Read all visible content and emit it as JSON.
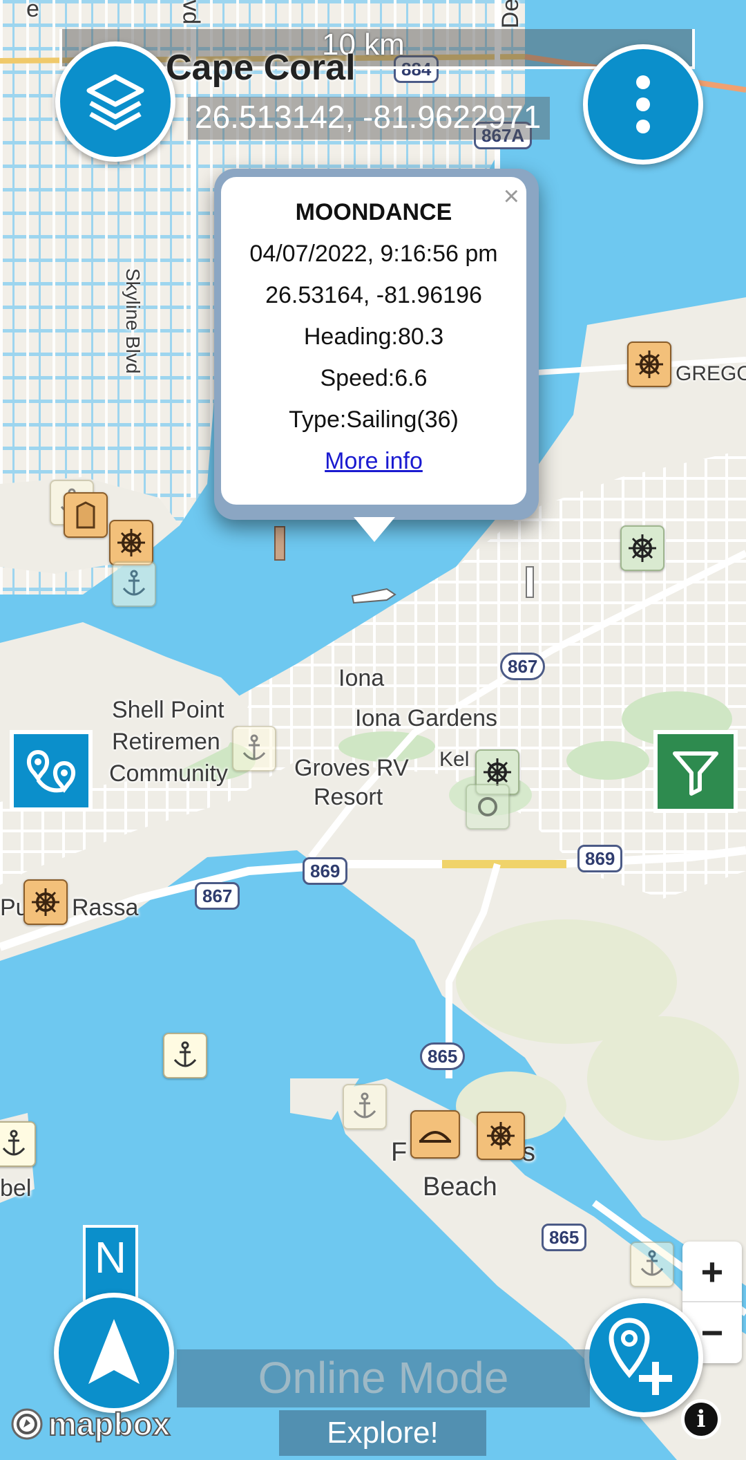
{
  "top_bar": {
    "scale_label": "10 km",
    "city_label": "Cape Coral",
    "coordinates": "26.513142, -81.9622971"
  },
  "popup": {
    "vessel_name": "MOONDANCE",
    "datetime": "04/07/2022, 9:16:56 pm",
    "position": "26.53164, -81.96196",
    "heading": "Heading:80.3",
    "speed": "Speed:6.6",
    "type": "Type:Sailing(36)",
    "more_info_link": "More info",
    "close_glyph": "×"
  },
  "map_labels": {
    "skyline": "Skyline Blvd",
    "gregory": "GREGO",
    "iona": "Iona",
    "iona_gardens": "Iona Gardens",
    "shell_point": "Shell Point",
    "retirement": "Retiremen",
    "community": "Community",
    "groves": "Groves RV",
    "resort": "Resort",
    "kel": "Kel",
    "punta_rassa_a": "Pu",
    "punta_rassa_b": "Rassa",
    "fort_myers_a": "F",
    "fort_myers_b": "s",
    "beach": "Beach",
    "sanibel": "bel",
    "top_left_road": "e",
    "top_road_d": "vd",
    "top_road_de": "De",
    "road_shields": [
      "884",
      "867A",
      "867",
      "869",
      "867",
      "869",
      "865",
      "865"
    ]
  },
  "controls": {
    "north_label": "N",
    "zoom_in": "+",
    "zoom_out": "−",
    "mode_text": "Online Mode",
    "explore_text": "Explore!",
    "mapbox_text": "mapbox",
    "info_glyph": "i"
  },
  "icons": {
    "layers": "layers-icon",
    "menu": "more-vertical-icon",
    "route": "route-icon",
    "filter": "filter-icon",
    "compass": "navigation-arrow-icon",
    "add_location": "add-location-icon",
    "anchor": "anchor-icon",
    "marina": "marina-icon"
  },
  "colors": {
    "water": "#6ec8f0",
    "land": "#f1eee5",
    "accent_blue": "#0b8fcb",
    "filter_green": "#2e8b4f",
    "link": "#1a1ad0"
  }
}
